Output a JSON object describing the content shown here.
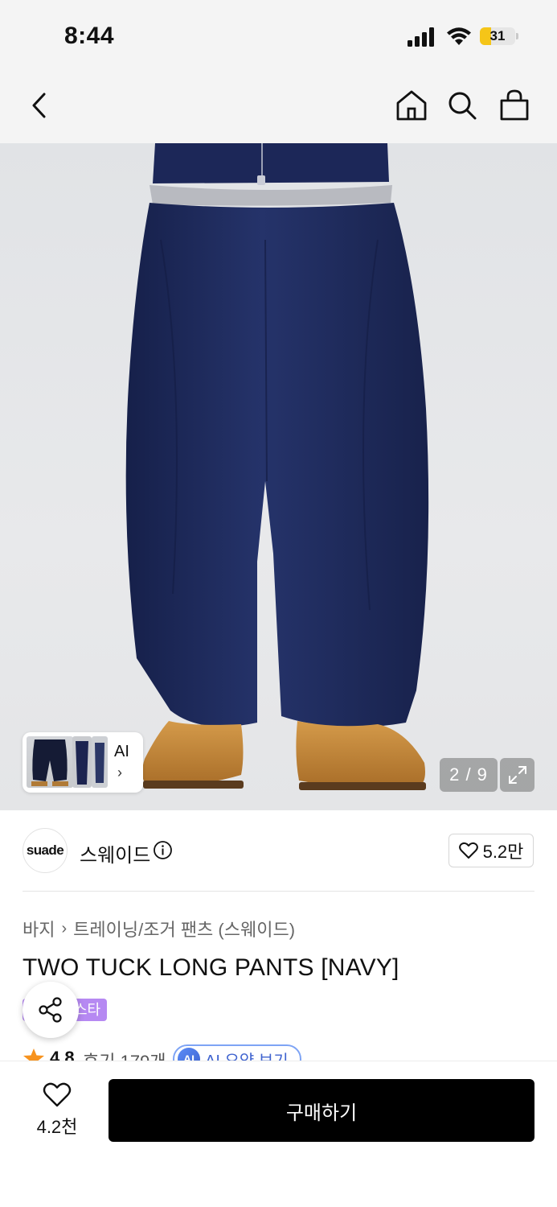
{
  "status_bar": {
    "time": "8:44",
    "battery_level": "31"
  },
  "nav": {
    "back_icon": "chevron-left-icon",
    "home_icon": "home-icon",
    "search_icon": "search-icon",
    "cart_icon": "shopping-bag-icon"
  },
  "gallery": {
    "thumb_label": "AI",
    "counter": "2 / 9",
    "expand_icon": "expand-icon"
  },
  "brand": {
    "logo_text": "suade",
    "name": "스웨이드",
    "likes": "5.2만"
  },
  "product": {
    "breadcrumb": [
      "바지",
      "트레이닝/조거 팬츠 (스웨이드)"
    ],
    "title": "TWO TUCK LONG PANTS [NAVY]",
    "tag": "스타",
    "rating": "4.8",
    "reviews": "후기 179개",
    "ai_summary": "AI 요약 보기",
    "ai_badge": "AI"
  },
  "bottom": {
    "wish_count": "4.2천",
    "buy_label": "구매하기"
  },
  "colors": {
    "navy": "#1f2b5a",
    "tag_purple": "#b689f2",
    "ai_blue": "#3f63cf",
    "star": "#f7931e"
  }
}
